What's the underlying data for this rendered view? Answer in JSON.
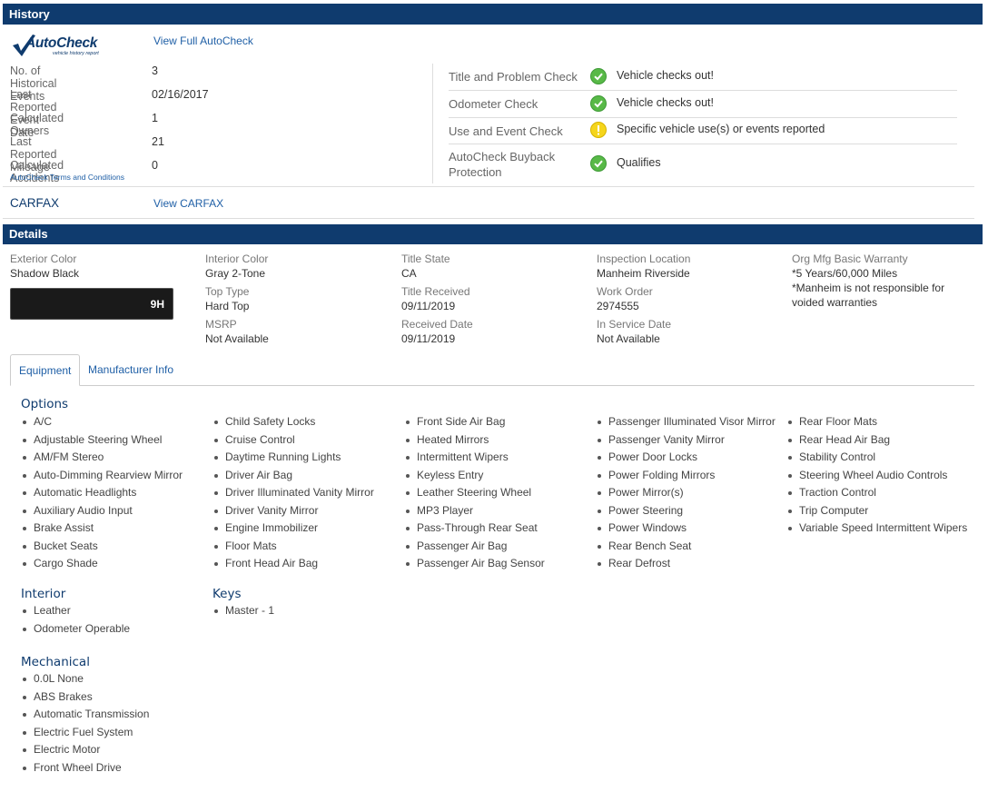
{
  "history": {
    "title": "History",
    "autocheck": {
      "logo_text": "AutoCheck",
      "logo_tagline": "vehicle history report",
      "view_link": "View Full AutoCheck",
      "rows": [
        {
          "label": "No. of Historical Events",
          "value": "3"
        },
        {
          "label": "Last Reported Event Date",
          "value": "02/16/2017"
        },
        {
          "label": "Calculated Owners",
          "value": "1"
        },
        {
          "label": "Last Reported Mileage",
          "value": "21"
        },
        {
          "label": "Calculated Accidents",
          "value": "0"
        }
      ],
      "terms_link": "AutoCheck Terms and Conditions",
      "checks": [
        {
          "label": "Title and Problem Check",
          "status": "Vehicle checks out!",
          "icon": "check-circle-icon"
        },
        {
          "label": "Odometer Check",
          "status": "Vehicle checks out!",
          "icon": "check-circle-icon"
        },
        {
          "label": "Use and Event Check",
          "status": "Specific vehicle use(s) or events reported",
          "icon": "warning-circle-icon"
        },
        {
          "label_line1": "AutoCheck Buyback",
          "label_line2": "Protection",
          "status": "Qualifies",
          "icon": "check-circle-icon"
        }
      ]
    },
    "carfax": {
      "label": "CARFAX",
      "view_link": "View CARFAX"
    }
  },
  "details": {
    "title": "Details",
    "exterior_color": {
      "label": "Exterior Color",
      "value": "Shadow Black",
      "swatch_code": "9H",
      "swatch_color": "#1a1a1a"
    },
    "interior_color": {
      "label": "Interior Color",
      "value": "Gray 2-Tone"
    },
    "top_type": {
      "label": "Top Type",
      "value": "Hard Top"
    },
    "msrp": {
      "label": "MSRP",
      "value": "Not Available"
    },
    "title_state": {
      "label": "Title State",
      "value": "CA"
    },
    "title_received": {
      "label": "Title Received",
      "value": "09/11/2019"
    },
    "received_date": {
      "label": "Received Date",
      "value": "09/11/2019"
    },
    "inspection_location": {
      "label": "Inspection Location",
      "value": "Manheim Riverside"
    },
    "work_order": {
      "label": "Work Order",
      "value": "2974555"
    },
    "in_service_date": {
      "label": "In Service Date",
      "value": "Not Available"
    },
    "warranty": {
      "label": "Org Mfg Basic Warranty",
      "line1": "*5 Years/60,000 Miles",
      "line2": "*Manheim is not responsible for",
      "line3": "voided warranties"
    }
  },
  "tabs": [
    {
      "label": "Equipment",
      "active": true
    },
    {
      "label": "Manufacturer Info",
      "active": false
    }
  ],
  "equipment": {
    "options_title": "Options",
    "options_col1": [
      "A/C",
      "Adjustable Steering Wheel",
      "AM/FM Stereo",
      "Auto-Dimming Rearview Mirror",
      "Automatic Headlights",
      "Auxiliary Audio Input",
      "Brake Assist",
      "Bucket Seats",
      "Cargo Shade"
    ],
    "options_col2": [
      "Child Safety Locks",
      "Cruise Control",
      "Daytime Running Lights",
      "Driver Air Bag",
      "Driver Illuminated Vanity Mirror",
      "Driver Vanity Mirror",
      "Engine Immobilizer",
      "Floor Mats",
      "Front Head Air Bag"
    ],
    "options_col3": [
      "Front Side Air Bag",
      "Heated Mirrors",
      "Intermittent Wipers",
      "Keyless Entry",
      "Leather Steering Wheel",
      "MP3 Player",
      "Pass-Through Rear Seat",
      "Passenger Air Bag",
      "Passenger Air Bag Sensor"
    ],
    "options_col4": [
      "Passenger Illuminated Visor Mirror",
      "Passenger Vanity Mirror",
      "Power Door Locks",
      "Power Folding Mirrors",
      "Power Mirror(s)",
      "Power Steering",
      "Power Windows",
      "Rear Bench Seat",
      "Rear Defrost"
    ],
    "options_col5": [
      "Rear Floor Mats",
      "Rear Head Air Bag",
      "Stability Control",
      "Steering Wheel Audio Controls",
      "Traction Control",
      "Trip Computer",
      "Variable Speed Intermittent Wipers"
    ],
    "interior_title": "Interior",
    "interior": [
      "Leather",
      "Odometer Operable"
    ],
    "keys_title": "Keys",
    "keys": [
      "Master - 1"
    ],
    "mechanical_title": "Mechanical",
    "mechanical": [
      "0.0L None",
      "ABS Brakes",
      "Automatic Transmission",
      "Electric Fuel System",
      "Electric Motor",
      "Front Wheel Drive"
    ]
  }
}
